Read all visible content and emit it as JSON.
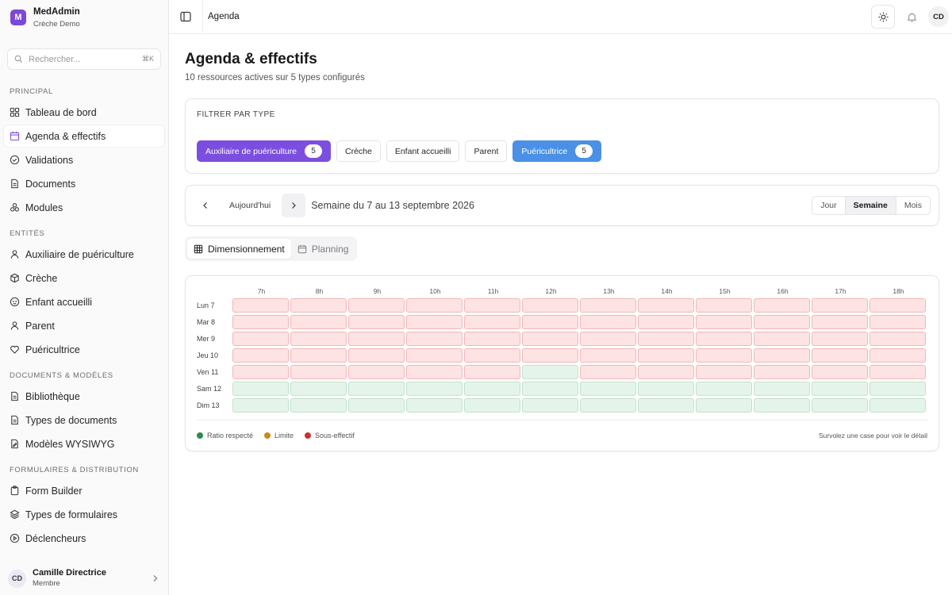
{
  "brand": {
    "initial": "M",
    "name": "MedAdmin",
    "sub": "Crèche Demo"
  },
  "search": {
    "placeholder": "Rechercher...",
    "shortcut": "⌘K"
  },
  "sidebar": {
    "sections": [
      {
        "label": "PRINCIPAL",
        "items": [
          {
            "label": "Tableau de bord",
            "icon": "grid-icon"
          },
          {
            "label": "Agenda & effectifs",
            "icon": "calendar-icon",
            "active": true
          },
          {
            "label": "Validations",
            "icon": "check-circle-icon"
          },
          {
            "label": "Documents",
            "icon": "file-icon"
          },
          {
            "label": "Modules",
            "icon": "boxes-icon"
          }
        ]
      },
      {
        "label": "ENTITÉS",
        "items": [
          {
            "label": "Auxiliaire de puériculture",
            "icon": "user-icon"
          },
          {
            "label": "Crèche",
            "icon": "cube-icon"
          },
          {
            "label": "Enfant accueilli",
            "icon": "baby-icon"
          },
          {
            "label": "Parent",
            "icon": "user-icon"
          },
          {
            "label": "Puéricultrice",
            "icon": "heart-icon"
          }
        ]
      },
      {
        "label": "DOCUMENTS & MODÈLES",
        "items": [
          {
            "label": "Bibliothèque",
            "icon": "file-icon"
          },
          {
            "label": "Types de documents",
            "icon": "file-icon"
          },
          {
            "label": "Modèles WYSIWYG",
            "icon": "file-edit-icon"
          }
        ]
      },
      {
        "label": "FORMULAIRES & DISTRIBUTION",
        "items": [
          {
            "label": "Form Builder",
            "icon": "clipboard-icon"
          },
          {
            "label": "Types de formulaires",
            "icon": "layers-icon"
          },
          {
            "label": "Déclencheurs",
            "icon": "play-circle-icon"
          }
        ]
      }
    ]
  },
  "user": {
    "initials": "CD",
    "name": "Camille Directrice",
    "role": "Membre"
  },
  "topbar": {
    "breadcrumb": "Agenda",
    "avatar": "CD"
  },
  "page": {
    "title": "Agenda & effectifs",
    "subtitle": "10 ressources actives sur 5 types configurés"
  },
  "filter": {
    "title": "FILTRER PAR TYPE",
    "chips": [
      {
        "label": "Auxiliaire de puériculture",
        "count": "5",
        "style": "violet",
        "color": "#7c4ee0"
      },
      {
        "label": "Crèche",
        "count": "",
        "style": "plain"
      },
      {
        "label": "Enfant accueilli",
        "count": "",
        "style": "plain"
      },
      {
        "label": "Parent",
        "count": "",
        "style": "plain"
      },
      {
        "label": "Puéricultrice",
        "count": "5",
        "style": "blue",
        "color": "#4a90e6"
      }
    ]
  },
  "calendar_nav": {
    "today": "Aujourd'hui",
    "week": "Semaine du 7 au 13 septembre 2026",
    "views": [
      "Jour",
      "Semaine",
      "Mois"
    ],
    "active_view": "Semaine"
  },
  "tabs": [
    {
      "label": "Dimensionnement",
      "icon": "table-icon",
      "active": true
    },
    {
      "label": "Planning",
      "icon": "calendar-icon",
      "active": false
    }
  ],
  "staffing": {
    "hours": [
      "7h",
      "8h",
      "9h",
      "10h",
      "11h",
      "12h",
      "13h",
      "14h",
      "15h",
      "16h",
      "17h",
      "18h"
    ],
    "days": [
      {
        "label": "Lun 7",
        "status": [
          "under",
          "under",
          "under",
          "under",
          "under",
          "under",
          "under",
          "under",
          "under",
          "under",
          "under",
          "under"
        ]
      },
      {
        "label": "Mar 8",
        "status": [
          "under",
          "under",
          "under",
          "under",
          "under",
          "under",
          "under",
          "under",
          "under",
          "under",
          "under",
          "under"
        ]
      },
      {
        "label": "Mer 9",
        "status": [
          "under",
          "under",
          "under",
          "under",
          "under",
          "under",
          "under",
          "under",
          "under",
          "under",
          "under",
          "under"
        ]
      },
      {
        "label": "Jeu 10",
        "status": [
          "under",
          "under",
          "under",
          "under",
          "under",
          "under",
          "under",
          "under",
          "under",
          "under",
          "under",
          "under"
        ]
      },
      {
        "label": "Ven 11",
        "status": [
          "under",
          "under",
          "under",
          "under",
          "under",
          "ok",
          "under",
          "under",
          "under",
          "under",
          "under",
          "under"
        ]
      },
      {
        "label": "Sam 12",
        "status": [
          "ok",
          "ok",
          "ok",
          "ok",
          "ok",
          "ok",
          "ok",
          "ok",
          "ok",
          "ok",
          "ok",
          "ok"
        ]
      },
      {
        "label": "Dim 13",
        "status": [
          "ok",
          "ok",
          "ok",
          "ok",
          "ok",
          "ok",
          "ok",
          "ok",
          "ok",
          "ok",
          "ok",
          "ok"
        ]
      }
    ],
    "legend": [
      {
        "label": "Ratio respecté",
        "color": "#2f8a4e"
      },
      {
        "label": "Limite",
        "color": "#c98a22"
      },
      {
        "label": "Sous-effectif",
        "color": "#c73232"
      }
    ],
    "hint": "Survolez une case pour voir le détail"
  }
}
